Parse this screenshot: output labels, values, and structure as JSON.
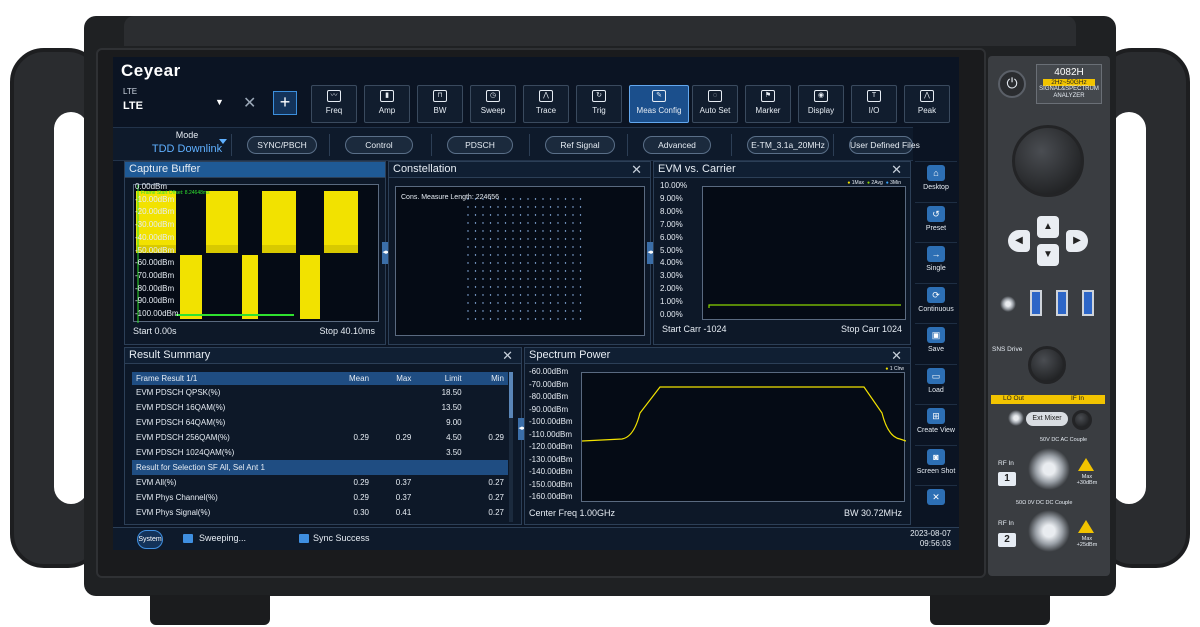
{
  "brand": "Ceyear",
  "instrument": {
    "model": "4082H",
    "range": "2Hz~50GHz",
    "type_line1": "SIGNAL&SPECTRUM",
    "type_line2": "ANALYZER",
    "labels": {
      "sns_drive": "SNS Drive",
      "lo_out": "LO Out",
      "if_in": "IF In",
      "ext_mixer": "Ext Mixer",
      "coupling1": "50V DC  AC Couple",
      "rf_in1": "RF In",
      "port1": "1",
      "max1": "Max +30dBm",
      "coupling2": "50Ω    0V DC  DC Couple",
      "rf_in2": "RF In",
      "port2": "2",
      "max2": "Max +25dBm"
    }
  },
  "mode": {
    "label_small": "LTE",
    "label_main": "LTE"
  },
  "toolbar": {
    "buttons": [
      {
        "label": "Freq",
        "icon": "freq-icon",
        "glyph": "〰"
      },
      {
        "label": "Amp",
        "icon": "amplitude-icon",
        "glyph": "▮"
      },
      {
        "label": "BW",
        "icon": "bandwidth-icon",
        "glyph": "⊓"
      },
      {
        "label": "Sweep",
        "icon": "sweep-icon",
        "glyph": "◷"
      },
      {
        "label": "Trace",
        "icon": "trace-icon",
        "glyph": "⋀"
      },
      {
        "label": "Trig",
        "icon": "trigger-icon",
        "glyph": "↻"
      },
      {
        "label": "Meas Config",
        "icon": "meas-config-icon",
        "glyph": "✎"
      },
      {
        "label": "Auto Set",
        "icon": "auto-set-icon",
        "glyph": "◌"
      },
      {
        "label": "Marker",
        "icon": "marker-icon",
        "glyph": "⚑"
      },
      {
        "label": "Display",
        "icon": "display-icon",
        "glyph": "◉"
      },
      {
        "label": "I/O",
        "icon": "io-icon",
        "glyph": "T"
      },
      {
        "label": "Peak",
        "icon": "peak-icon",
        "glyph": "⋀"
      }
    ]
  },
  "subbar": {
    "mode_label": "Mode",
    "mode_value": "TDD Downlink",
    "pills": [
      "SYNC/PBCH",
      "Control",
      "PDSCH",
      "Ref Signal",
      "Advanced",
      "E-TM_3.1a_20MHz",
      "User Defined Files"
    ]
  },
  "capture_buffer": {
    "title": "Capture Buffer",
    "marker_text": "Frame Start Offset: 8.24648ms",
    "y_labels": [
      "0.00dBm",
      "-10.00dBm",
      "-20.00dBm",
      "-30.00dBm",
      "-40.00dBm",
      "-50.00dBm",
      "-60.00dBm",
      "-70.00dBm",
      "-80.00dBm",
      "-90.00dBm",
      "-100.00dBm"
    ],
    "start": "Start 0.00s",
    "stop": "Stop 40.10ms"
  },
  "constellation": {
    "title": "Constellation",
    "info": "Cons. Measure Length: 224656"
  },
  "evm_carrier": {
    "title": "EVM vs. Carrier",
    "legend": [
      "1Max",
      "2Avg",
      "3Min"
    ],
    "legend_colors": [
      "#f2e200",
      "#8ad400",
      "#39a6ff"
    ],
    "y_labels": [
      "10.00%",
      "9.00%",
      "8.00%",
      "7.00%",
      "6.00%",
      "5.00%",
      "4.00%",
      "3.00%",
      "2.00%",
      "1.00%",
      "0.00%"
    ],
    "start": "Start Carr -1024",
    "stop": "Stop Carr  1024"
  },
  "result_summary": {
    "title": "Result Summary",
    "columns": [
      "Frame Result 1/1",
      "Mean",
      "Max",
      "Limit",
      "Min"
    ],
    "rows": [
      [
        "EVM PDSCH QPSK(%)",
        "",
        "",
        "18.50",
        ""
      ],
      [
        "EVM PDSCH 16QAM(%)",
        "",
        "",
        "13.50",
        ""
      ],
      [
        "EVM PDSCH 64QAM(%)",
        "",
        "",
        "9.00",
        ""
      ],
      [
        "EVM PDSCH 256QAM(%)",
        "0.29",
        "0.29",
        "4.50",
        "0.29"
      ],
      [
        "EVM PDSCH 1024QAM(%)",
        "",
        "",
        "3.50",
        ""
      ]
    ],
    "band": "Result for Selection SF All, Sel Ant 1",
    "rows2": [
      [
        "EVM All(%)",
        "0.29",
        "0.37",
        "",
        "0.27"
      ],
      [
        "EVM Phys Channel(%)",
        "0.29",
        "0.37",
        "",
        "0.27"
      ],
      [
        "EVM Phys Signal(%)",
        "0.30",
        "0.41",
        "",
        "0.27"
      ]
    ]
  },
  "spectrum_power": {
    "title": "Spectrum Power",
    "legend": "1 Clrw",
    "y_labels": [
      "-60.00dBm",
      "-70.00dBm",
      "-80.00dBm",
      "-90.00dBm",
      "-100.00dBm",
      "-110.00dBm",
      "-120.00dBm",
      "-130.00dBm",
      "-140.00dBm",
      "-150.00dBm",
      "-160.00dBm"
    ],
    "center": "Center Freq 1.00GHz",
    "bw": "BW 30.72MHz"
  },
  "side_toolbar": [
    {
      "label": "Desktop",
      "icon": "home-icon",
      "glyph": "⌂"
    },
    {
      "label": "Preset",
      "icon": "preset-icon",
      "glyph": "↺"
    },
    {
      "label": "Single",
      "icon": "single-icon",
      "glyph": "→"
    },
    {
      "label": "Continuous",
      "icon": "continuous-icon",
      "glyph": "⟳"
    },
    {
      "label": "Save",
      "icon": "save-icon",
      "glyph": "▣"
    },
    {
      "label": "Load",
      "icon": "folder-icon",
      "glyph": "▭"
    },
    {
      "label": "Create View",
      "icon": "create-view-icon",
      "glyph": "⊞"
    },
    {
      "label": "Screen Shot",
      "icon": "camera-icon",
      "glyph": "◙"
    },
    {
      "label": "",
      "icon": "collapse-icon",
      "glyph": "✕"
    }
  ],
  "status": {
    "system": "System",
    "sweeping": "Sweeping...",
    "sync": "Sync Success",
    "date": "2023-08-07",
    "time": "09:56:03"
  },
  "colors": {
    "accent": "#1f5a96",
    "trace_yellow": "#f2e200",
    "trace_green": "#2fe22f"
  }
}
